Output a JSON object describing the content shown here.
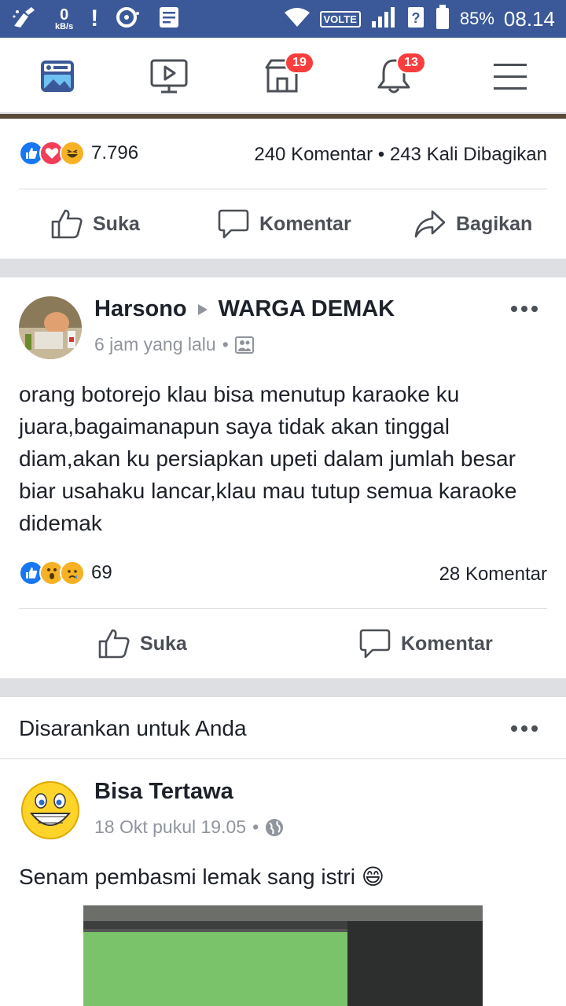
{
  "status_bar": {
    "speed_value": "0",
    "speed_unit": "kB/s",
    "network": "VOLTE",
    "battery": "85%",
    "time": "08.14"
  },
  "nav": {
    "marketplace_badge": "19",
    "notifications_badge": "13"
  },
  "post1": {
    "reaction_count": "7.796",
    "stats": "240 Komentar • 243 Kali Dibagikan",
    "actions": {
      "like": "Suka",
      "comment": "Komentar",
      "share": "Bagikan"
    }
  },
  "post2": {
    "author": "Harsono",
    "group": "WARGA DEMAK",
    "time": "6 jam yang lalu",
    "text": "orang botorejo klau bisa menutup karaoke ku juara,bagaimanapun saya tidak akan tinggal diam,akan ku persiapkan upeti dalam jumlah besar biar usahaku lancar,klau mau tutup semua karaoke didemak",
    "reaction_count": "69",
    "comments": "28 Komentar",
    "actions": {
      "like": "Suka",
      "comment": "Komentar"
    }
  },
  "suggested": {
    "heading": "Disarankan untuk Anda",
    "author": "Bisa Tertawa",
    "time": "18 Okt pukul 19.05",
    "text": "Senam pembasmi lemak sang istri 😄"
  },
  "colors": {
    "brand": "#3b5998",
    "badge": "#fa3e3e",
    "like": "#1877f2",
    "love": "#f33e58",
    "haha": "#f7b125"
  }
}
